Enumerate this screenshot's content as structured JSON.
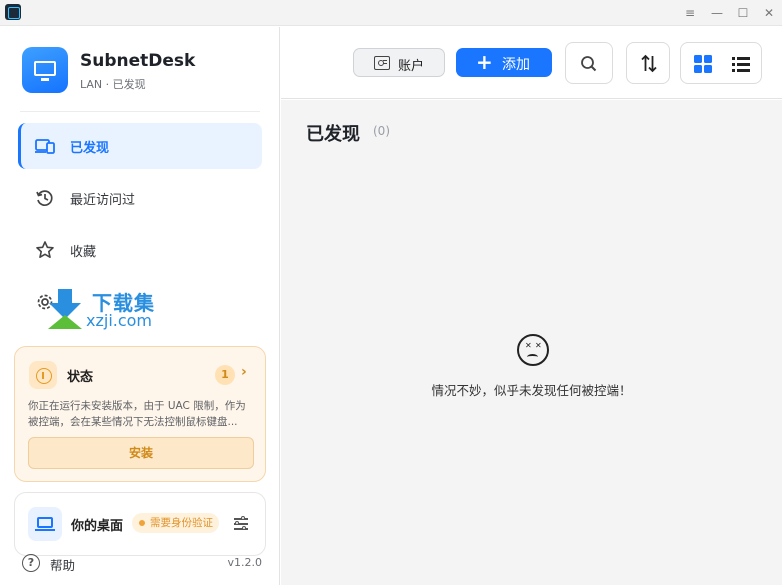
{
  "window": {
    "minimize_glyph": "—",
    "maximize_glyph": "☐",
    "close_glyph": "✕",
    "menu_glyph": "≡"
  },
  "brand": {
    "name": "SubnetDesk",
    "subtitle": "LAN · 已发现"
  },
  "nav": [
    {
      "label": "已发现",
      "icon": "devices-icon",
      "active": true
    },
    {
      "label": "最近访问过",
      "icon": "history-icon",
      "active": false
    },
    {
      "label": "收藏",
      "icon": "star-icon",
      "active": false
    },
    {
      "label": "设置",
      "icon": "gear-icon",
      "active": false
    }
  ],
  "watermark": {
    "line1": "下载集",
    "line2": "xzji.com"
  },
  "status_card": {
    "title": "状态",
    "count": "1",
    "description": "你正在运行未安装版本，由于 UAC 限制，作为被控端，会在某些情况下无法控制鼠标键盘...",
    "install_label": "安装"
  },
  "desktop_card": {
    "title": "你的桌面",
    "badge": "需要身份验证"
  },
  "footer": {
    "help_label": "帮助",
    "version": "v1.2.0"
  },
  "toolbar": {
    "account_label": "账户",
    "add_label": "添加"
  },
  "main": {
    "section_title": "已发现",
    "section_count": "(0)",
    "empty_message": "情况不妙，似乎未发现任何被控端！"
  },
  "colors": {
    "accent": "#1a75ff",
    "warning": "#e39b23",
    "content_bg": "#f4f4f5"
  }
}
